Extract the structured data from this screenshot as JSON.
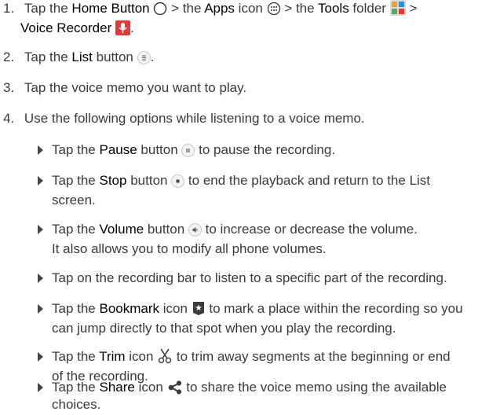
{
  "steps": [
    {
      "num": "1.",
      "t1": "Tap the ",
      "b1": "Home Button",
      "t2": " > the ",
      "b2": "Apps",
      "t3": " icon ",
      "t4": " > the ",
      "b3": "Tools",
      "t5": " folder ",
      "t6": " >",
      "b4": "Voice Recorder",
      "t7": "."
    },
    {
      "num": "2.",
      "t1": "Tap the ",
      "b1": "List",
      "t2": " button ",
      "t3": "."
    },
    {
      "num": "3.",
      "t1": "Tap the voice memo you want to play."
    },
    {
      "num": "4.",
      "t1": "Use the following options while listening to a voice memo."
    }
  ],
  "bullets": [
    {
      "t1": "Tap the ",
      "b1": "Pause",
      "t2": " button ",
      "t3": " to pause the recording."
    },
    {
      "t1": "Tap the ",
      "b1": "Stop",
      "t2": " button ",
      "t3": " to end the playback and return to the List",
      "t4": "screen."
    },
    {
      "t1": "Tap the ",
      "b1": "Volume",
      "t2": " button ",
      "t3": " to increase or decrease the volume.",
      "t4": "It also allows you to modify all phone volumes."
    },
    {
      "t1": "Tap on the recording bar to listen to a specific part of the recording."
    },
    {
      "t1": "Tap the ",
      "b1": "Bookmark",
      "t2": " icon ",
      "t3": " to mark a place within the recording so you",
      "t4": "can jump directly to that spot when you play the recording."
    },
    {
      "t1": "Tap the ",
      "b1": "Trim",
      "t2": " icon ",
      "t3": " to trim away segments at the beginning or end",
      "t4": "of the recording."
    },
    {
      "t1": "Tap the ",
      "b1": "Share",
      "t2": " icon ",
      "t3": " to share the voice memo using the available",
      "t4": "choices."
    }
  ],
  "icons": {
    "home": "home-button-icon",
    "apps": "apps-icon",
    "tools": "tools-folder-icon",
    "recorder": "voice-recorder-icon",
    "list": "list-button-icon",
    "pause": "pause-button-icon",
    "stop": "stop-button-icon",
    "volume": "volume-button-icon",
    "bookmark": "bookmark-icon",
    "trim": "trim-icon",
    "share": "share-icon"
  },
  "colors": {
    "text": "#3a3a3a",
    "bold": "#000000",
    "recorder_red": "#e53935"
  }
}
